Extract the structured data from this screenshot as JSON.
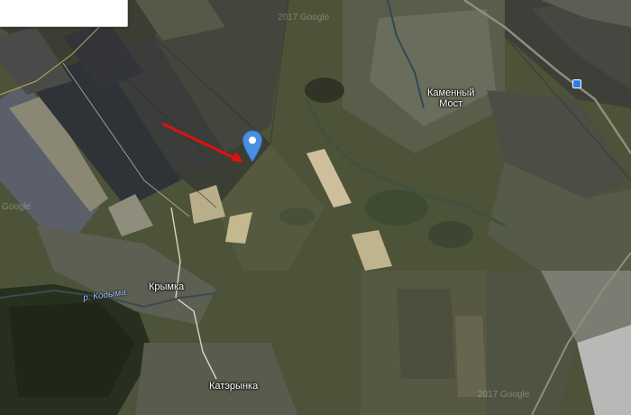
{
  "search": {
    "value": "",
    "placeholder": ""
  },
  "places": {
    "kamennyi_most": "Каменный\nМост",
    "krymka": "Крымка",
    "katerynka": "Катэрынка"
  },
  "river": "р. Кодыма",
  "watermarks": {
    "left": "Google",
    "top": "2017 Google",
    "bottom": "2017 Google"
  },
  "pin": {
    "icon": "map-pin-icon",
    "color": "#4a90e2"
  },
  "arrow": {
    "color": "#e01010"
  },
  "railway_marker": {
    "icon": "railway-station-icon",
    "color": "#2d7de0"
  }
}
